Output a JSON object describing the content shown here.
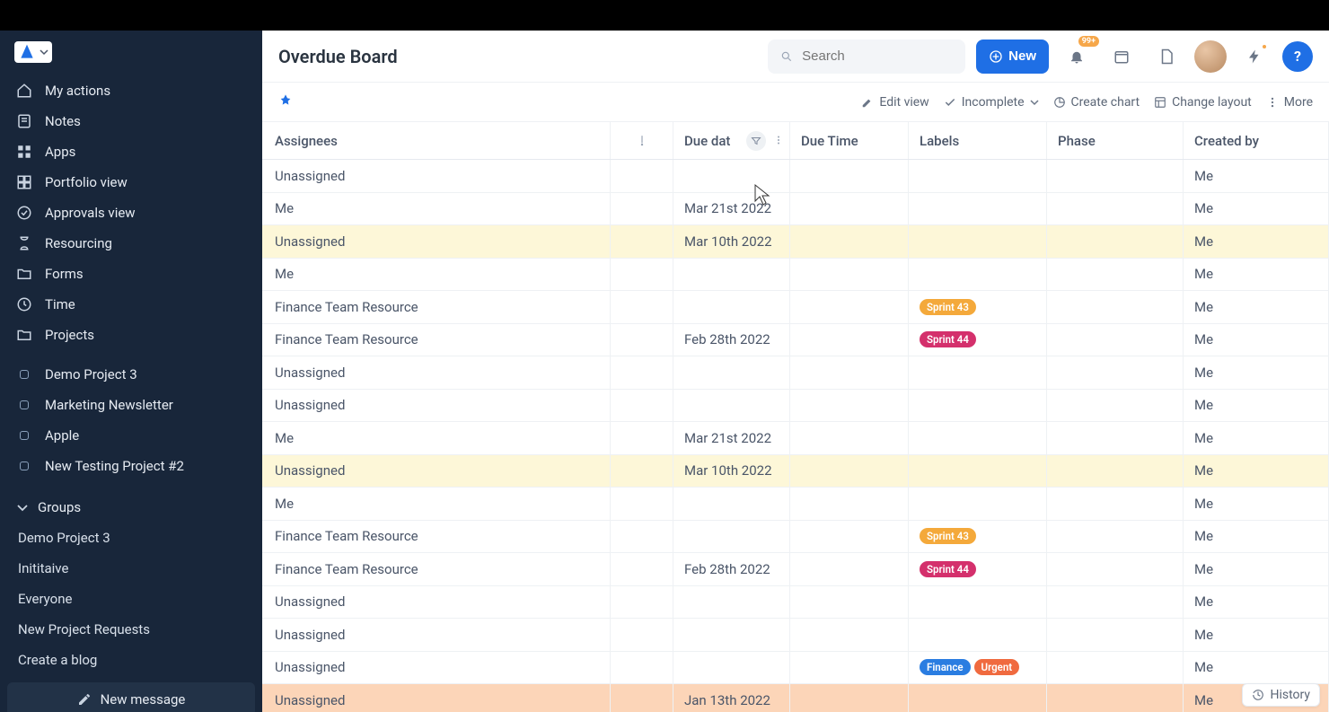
{
  "sidebar": {
    "nav": [
      {
        "label": "My actions",
        "icon": "home"
      },
      {
        "label": "Notes",
        "icon": "note"
      },
      {
        "label": "Apps",
        "icon": "apps"
      },
      {
        "label": "Portfolio view",
        "icon": "grid"
      },
      {
        "label": "Approvals view",
        "icon": "check-circle"
      },
      {
        "label": "Resourcing",
        "icon": "hourglass"
      },
      {
        "label": "Forms",
        "icon": "folder"
      },
      {
        "label": "Time",
        "icon": "clock"
      },
      {
        "label": "Projects",
        "icon": "folder"
      }
    ],
    "projects": [
      {
        "label": "Demo Project 3"
      },
      {
        "label": "Marketing Newsletter"
      },
      {
        "label": "Apple"
      },
      {
        "label": "New Testing Project #2"
      }
    ],
    "groups_label": "Groups",
    "groups": [
      {
        "label": "Demo Project 3"
      },
      {
        "label": "Inititaive"
      },
      {
        "label": "Everyone"
      },
      {
        "label": "New Project Requests"
      },
      {
        "label": "Create a blog"
      }
    ],
    "new_message": "New message"
  },
  "header": {
    "title": "Overdue Board",
    "search_placeholder": "Search",
    "new_label": "New",
    "notif_badge": "99+"
  },
  "toolbar": {
    "edit_view": "Edit view",
    "incomplete": "Incomplete",
    "create_chart": "Create chart",
    "change_layout": "Change layout",
    "more": "More"
  },
  "columns": {
    "assignees": "Assignees",
    "due_date": "Due dat",
    "due_time": "Due Time",
    "labels": "Labels",
    "phase": "Phase",
    "created_by": "Created by"
  },
  "label_colors": {
    "Sprint 43": "#f4a93b",
    "Sprint 44": "#d4306c",
    "Finance": "#2a7de1",
    "Urgent": "#f06a3f"
  },
  "rows": [
    {
      "assignee": "Unassigned",
      "due_date": "",
      "labels": [],
      "created_by": "Me",
      "highlight": ""
    },
    {
      "assignee": "Me",
      "due_date": "Mar 21st 2022",
      "labels": [],
      "created_by": "Me",
      "highlight": ""
    },
    {
      "assignee": "Unassigned",
      "due_date": "Mar 10th 2022",
      "labels": [],
      "created_by": "Me",
      "highlight": "yellow"
    },
    {
      "assignee": "Me",
      "due_date": "",
      "labels": [],
      "created_by": "Me",
      "highlight": ""
    },
    {
      "assignee": "Finance Team Resource",
      "due_date": "",
      "labels": [
        "Sprint 43"
      ],
      "created_by": "Me",
      "highlight": ""
    },
    {
      "assignee": "Finance Team Resource",
      "due_date": "Feb 28th 2022",
      "labels": [
        "Sprint 44"
      ],
      "created_by": "Me",
      "highlight": ""
    },
    {
      "assignee": "Unassigned",
      "due_date": "",
      "labels": [],
      "created_by": "Me",
      "highlight": ""
    },
    {
      "assignee": "Unassigned",
      "due_date": "",
      "labels": [],
      "created_by": "Me",
      "highlight": ""
    },
    {
      "assignee": "Me",
      "due_date": "Mar 21st 2022",
      "labels": [],
      "created_by": "Me",
      "highlight": ""
    },
    {
      "assignee": "Unassigned",
      "due_date": "Mar 10th 2022",
      "labels": [],
      "created_by": "Me",
      "highlight": "yellow"
    },
    {
      "assignee": "Me",
      "due_date": "",
      "labels": [],
      "created_by": "Me",
      "highlight": ""
    },
    {
      "assignee": "Finance Team Resource",
      "due_date": "",
      "labels": [
        "Sprint 43"
      ],
      "created_by": "Me",
      "highlight": ""
    },
    {
      "assignee": "Finance Team Resource",
      "due_date": "Feb 28th 2022",
      "labels": [
        "Sprint 44"
      ],
      "created_by": "Me",
      "highlight": ""
    },
    {
      "assignee": "Unassigned",
      "due_date": "",
      "labels": [],
      "created_by": "Me",
      "highlight": ""
    },
    {
      "assignee": "Unassigned",
      "due_date": "",
      "labels": [],
      "created_by": "Me",
      "highlight": ""
    },
    {
      "assignee": "Unassigned",
      "due_date": "",
      "labels": [
        "Finance",
        "Urgent"
      ],
      "created_by": "Me",
      "highlight": ""
    },
    {
      "assignee": "Unassigned",
      "due_date": "Jan 13th 2022",
      "labels": [],
      "created_by": "Me",
      "highlight": "orange"
    }
  ],
  "history": "History"
}
